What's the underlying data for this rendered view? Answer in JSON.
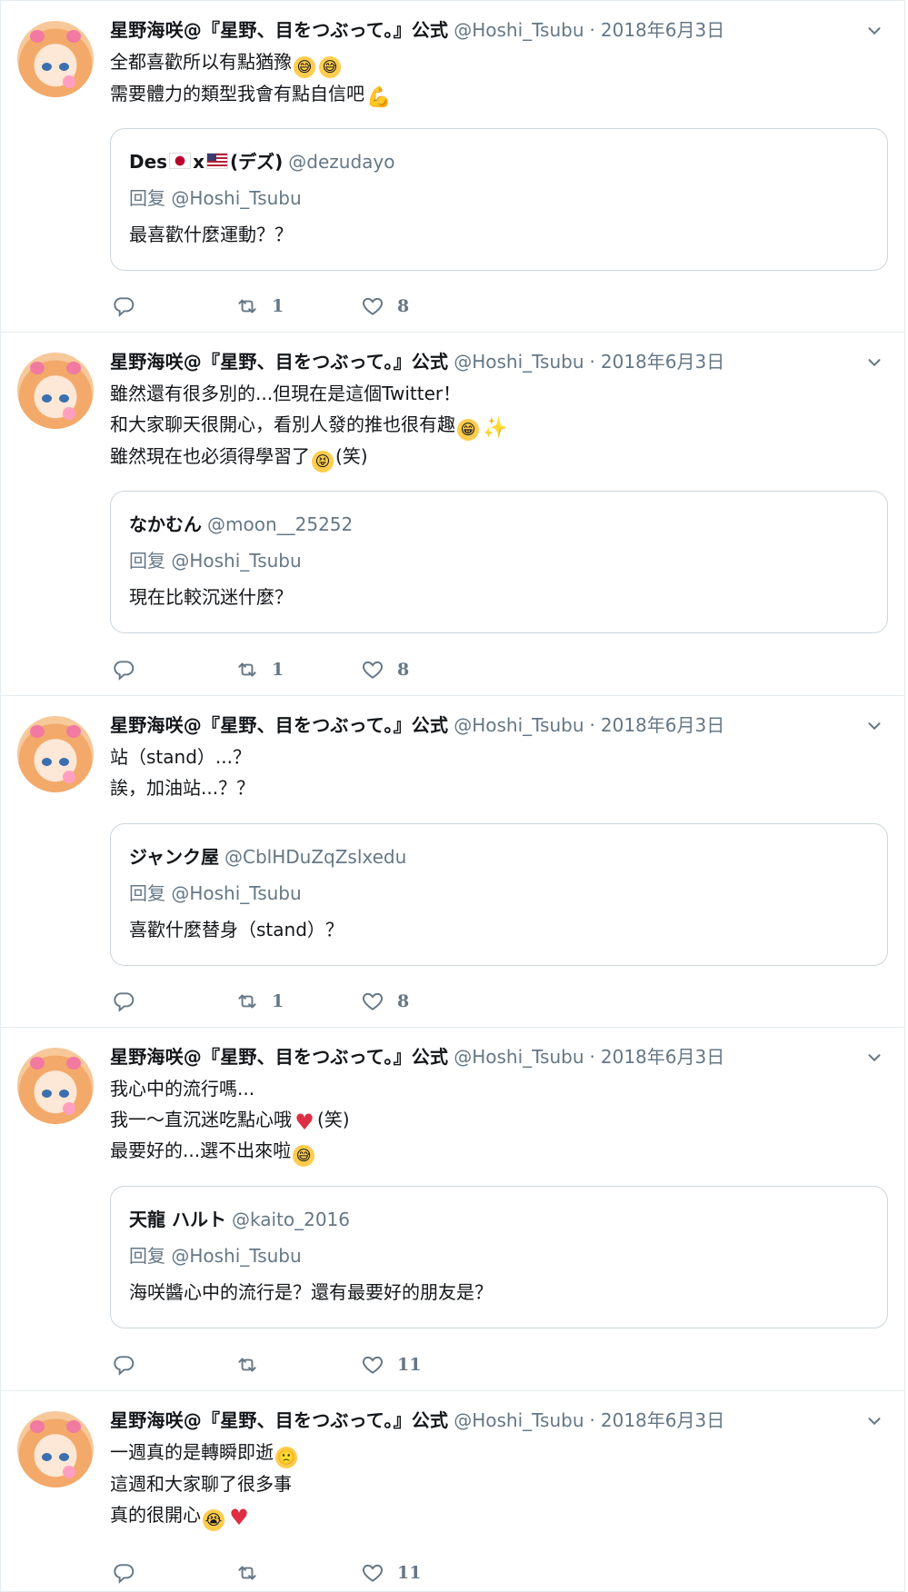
{
  "tweets": [
    {
      "author": {
        "name": "星野海咲@『星野、目をつぶって。』公式",
        "handle": "@Hoshi_Tsubu"
      },
      "dot": "·",
      "date": "2018年6月3日",
      "lines": [
        [
          {
            "t": "全都喜歡所以有點猶豫"
          },
          {
            "e": "sweat-smile"
          },
          {
            "e": "sweat-smile"
          }
        ],
        [
          {
            "t": "需要體力的類型我會有點自信吧"
          },
          {
            "e": "flexed-biceps"
          }
        ]
      ],
      "quote": {
        "name_parts": [
          {
            "t": "Des"
          },
          {
            "flag": "jp"
          },
          {
            "t": "x"
          },
          {
            "flag": "us"
          },
          {
            "t": "(デズ)"
          }
        ],
        "handle": "@dezudayo",
        "reply": "回复 @Hoshi_Tsubu",
        "text": "最喜歡什麼運動？？"
      },
      "stats": {
        "replies": "",
        "retweets": "1",
        "likes": "8"
      }
    },
    {
      "author": {
        "name": "星野海咲@『星野、目をつぶって。』公式",
        "handle": "@Hoshi_Tsubu"
      },
      "dot": "·",
      "date": "2018年6月3日",
      "lines": [
        [
          {
            "t": "雖然還有很多別的...但現在是這個Twitter！"
          }
        ],
        [
          {
            "t": "和大家聊天很開心，看別人發的推也很有趣"
          },
          {
            "e": "grinning"
          },
          {
            "e": "sparkles"
          }
        ],
        [
          {
            "t": "雖然現在也必須得學習了"
          },
          {
            "e": "squinting-tongue"
          },
          {
            "t": "(笑)"
          }
        ]
      ],
      "quote": {
        "name_parts": [
          {
            "t": "なかむん"
          }
        ],
        "handle": "@moon__25252",
        "reply": "回复 @Hoshi_Tsubu",
        "text": "現在比較沉迷什麼？"
      },
      "stats": {
        "replies": "",
        "retweets": "1",
        "likes": "8"
      }
    },
    {
      "author": {
        "name": "星野海咲@『星野、目をつぶって。』公式",
        "handle": "@Hoshi_Tsubu"
      },
      "dot": "·",
      "date": "2018年6月3日",
      "lines": [
        [
          {
            "t": "站（stand）...？"
          }
        ],
        [
          {
            "t": "誒，加油站...？？"
          }
        ]
      ],
      "quote": {
        "name_parts": [
          {
            "t": "ジャンク屋"
          }
        ],
        "handle": "@CblHDuZqZslxedu",
        "reply": "回复 @Hoshi_Tsubu",
        "text": "喜歡什麼替身（stand）？"
      },
      "stats": {
        "replies": "",
        "retweets": "1",
        "likes": "8"
      }
    },
    {
      "author": {
        "name": "星野海咲@『星野、目をつぶって。』公式",
        "handle": "@Hoshi_Tsubu"
      },
      "dot": "·",
      "date": "2018年6月3日",
      "lines": [
        [
          {
            "t": "我心中的流行嗎..."
          }
        ],
        [
          {
            "t": "我一～直沉迷吃點心哦"
          },
          {
            "e": "red-heart"
          },
          {
            "t": "(笑)"
          }
        ],
        [
          {
            "t": "最要好的...選不出來啦"
          },
          {
            "e": "sweat-smile"
          }
        ]
      ],
      "quote": {
        "name_parts": [
          {
            "t": "天龍 ハルト"
          }
        ],
        "handle": "@kaito_2016",
        "reply": "回复 @Hoshi_Tsubu",
        "text": "海咲醬心中的流行是？還有最要好的朋友是？"
      },
      "stats": {
        "replies": "",
        "retweets": "",
        "likes": "11"
      }
    },
    {
      "author": {
        "name": "星野海咲@『星野、目をつぶって。』公式",
        "handle": "@Hoshi_Tsubu"
      },
      "dot": "·",
      "date": "2018年6月3日",
      "lines": [
        [
          {
            "t": "一週真的是轉瞬即逝"
          },
          {
            "e": "slightly-frowning"
          }
        ],
        [
          {
            "t": "這週和大家聊了很多事"
          }
        ],
        [
          {
            "t": "真的很開心"
          },
          {
            "e": "loudly-crying"
          },
          {
            "e": "red-heart"
          }
        ]
      ],
      "quote": null,
      "stats": {
        "replies": "",
        "retweets": "",
        "likes": "11"
      }
    }
  ]
}
